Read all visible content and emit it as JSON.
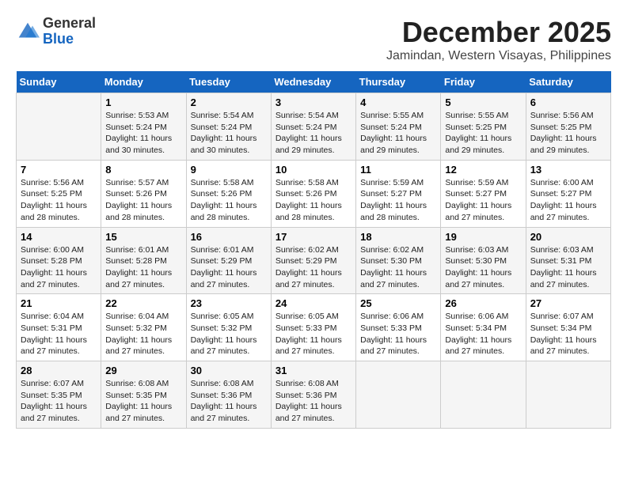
{
  "header": {
    "logo_general": "General",
    "logo_blue": "Blue",
    "month": "December 2025",
    "location": "Jamindan, Western Visayas, Philippines"
  },
  "weekdays": [
    "Sunday",
    "Monday",
    "Tuesday",
    "Wednesday",
    "Thursday",
    "Friday",
    "Saturday"
  ],
  "weeks": [
    [
      {
        "day": "",
        "info": ""
      },
      {
        "day": "1",
        "info": "Sunrise: 5:53 AM\nSunset: 5:24 PM\nDaylight: 11 hours\nand 30 minutes."
      },
      {
        "day": "2",
        "info": "Sunrise: 5:54 AM\nSunset: 5:24 PM\nDaylight: 11 hours\nand 30 minutes."
      },
      {
        "day": "3",
        "info": "Sunrise: 5:54 AM\nSunset: 5:24 PM\nDaylight: 11 hours\nand 29 minutes."
      },
      {
        "day": "4",
        "info": "Sunrise: 5:55 AM\nSunset: 5:24 PM\nDaylight: 11 hours\nand 29 minutes."
      },
      {
        "day": "5",
        "info": "Sunrise: 5:55 AM\nSunset: 5:25 PM\nDaylight: 11 hours\nand 29 minutes."
      },
      {
        "day": "6",
        "info": "Sunrise: 5:56 AM\nSunset: 5:25 PM\nDaylight: 11 hours\nand 29 minutes."
      }
    ],
    [
      {
        "day": "7",
        "info": "Sunrise: 5:56 AM\nSunset: 5:25 PM\nDaylight: 11 hours\nand 28 minutes."
      },
      {
        "day": "8",
        "info": "Sunrise: 5:57 AM\nSunset: 5:26 PM\nDaylight: 11 hours\nand 28 minutes."
      },
      {
        "day": "9",
        "info": "Sunrise: 5:58 AM\nSunset: 5:26 PM\nDaylight: 11 hours\nand 28 minutes."
      },
      {
        "day": "10",
        "info": "Sunrise: 5:58 AM\nSunset: 5:26 PM\nDaylight: 11 hours\nand 28 minutes."
      },
      {
        "day": "11",
        "info": "Sunrise: 5:59 AM\nSunset: 5:27 PM\nDaylight: 11 hours\nand 28 minutes."
      },
      {
        "day": "12",
        "info": "Sunrise: 5:59 AM\nSunset: 5:27 PM\nDaylight: 11 hours\nand 27 minutes."
      },
      {
        "day": "13",
        "info": "Sunrise: 6:00 AM\nSunset: 5:27 PM\nDaylight: 11 hours\nand 27 minutes."
      }
    ],
    [
      {
        "day": "14",
        "info": "Sunrise: 6:00 AM\nSunset: 5:28 PM\nDaylight: 11 hours\nand 27 minutes."
      },
      {
        "day": "15",
        "info": "Sunrise: 6:01 AM\nSunset: 5:28 PM\nDaylight: 11 hours\nand 27 minutes."
      },
      {
        "day": "16",
        "info": "Sunrise: 6:01 AM\nSunset: 5:29 PM\nDaylight: 11 hours\nand 27 minutes."
      },
      {
        "day": "17",
        "info": "Sunrise: 6:02 AM\nSunset: 5:29 PM\nDaylight: 11 hours\nand 27 minutes."
      },
      {
        "day": "18",
        "info": "Sunrise: 6:02 AM\nSunset: 5:30 PM\nDaylight: 11 hours\nand 27 minutes."
      },
      {
        "day": "19",
        "info": "Sunrise: 6:03 AM\nSunset: 5:30 PM\nDaylight: 11 hours\nand 27 minutes."
      },
      {
        "day": "20",
        "info": "Sunrise: 6:03 AM\nSunset: 5:31 PM\nDaylight: 11 hours\nand 27 minutes."
      }
    ],
    [
      {
        "day": "21",
        "info": "Sunrise: 6:04 AM\nSunset: 5:31 PM\nDaylight: 11 hours\nand 27 minutes."
      },
      {
        "day": "22",
        "info": "Sunrise: 6:04 AM\nSunset: 5:32 PM\nDaylight: 11 hours\nand 27 minutes."
      },
      {
        "day": "23",
        "info": "Sunrise: 6:05 AM\nSunset: 5:32 PM\nDaylight: 11 hours\nand 27 minutes."
      },
      {
        "day": "24",
        "info": "Sunrise: 6:05 AM\nSunset: 5:33 PM\nDaylight: 11 hours\nand 27 minutes."
      },
      {
        "day": "25",
        "info": "Sunrise: 6:06 AM\nSunset: 5:33 PM\nDaylight: 11 hours\nand 27 minutes."
      },
      {
        "day": "26",
        "info": "Sunrise: 6:06 AM\nSunset: 5:34 PM\nDaylight: 11 hours\nand 27 minutes."
      },
      {
        "day": "27",
        "info": "Sunrise: 6:07 AM\nSunset: 5:34 PM\nDaylight: 11 hours\nand 27 minutes."
      }
    ],
    [
      {
        "day": "28",
        "info": "Sunrise: 6:07 AM\nSunset: 5:35 PM\nDaylight: 11 hours\nand 27 minutes."
      },
      {
        "day": "29",
        "info": "Sunrise: 6:08 AM\nSunset: 5:35 PM\nDaylight: 11 hours\nand 27 minutes."
      },
      {
        "day": "30",
        "info": "Sunrise: 6:08 AM\nSunset: 5:36 PM\nDaylight: 11 hours\nand 27 minutes."
      },
      {
        "day": "31",
        "info": "Sunrise: 6:08 AM\nSunset: 5:36 PM\nDaylight: 11 hours\nand 27 minutes."
      },
      {
        "day": "",
        "info": ""
      },
      {
        "day": "",
        "info": ""
      },
      {
        "day": "",
        "info": ""
      }
    ]
  ]
}
